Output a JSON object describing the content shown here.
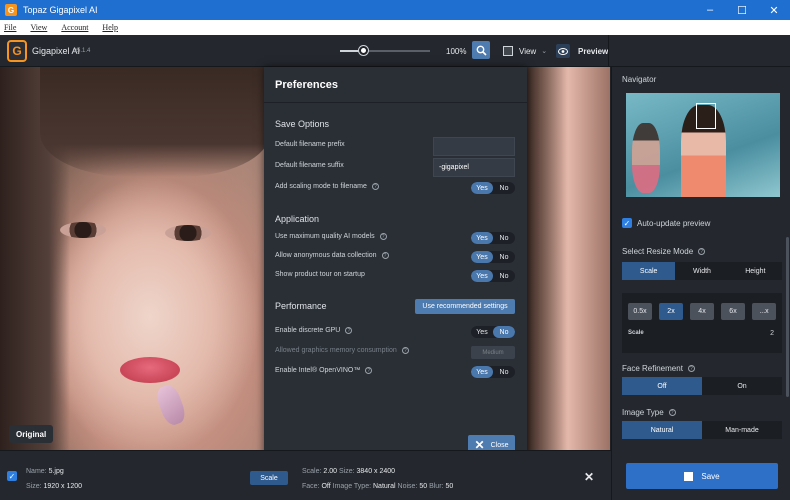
{
  "window": {
    "title": "Topaz Gigapixel AI",
    "app_icon_letter": "G",
    "minimize": "–",
    "maximize": "☐",
    "close": "✕"
  },
  "menu": [
    "File",
    "View",
    "Account",
    "Help"
  ],
  "toolbar": {
    "logo_letter": "G",
    "app_name": "Gigapixel AI",
    "version": "v5.1.4",
    "zoom_value": "100%",
    "view_label": "View",
    "preview_label": "Preview"
  },
  "image": {
    "original_label": "Original"
  },
  "preferences": {
    "title": "Preferences",
    "save_options": {
      "title": "Save Options",
      "prefix_label": "Default filename prefix",
      "prefix_value": "",
      "suffix_label": "Default filename suffix",
      "suffix_value": "-gigapixel",
      "add_scaling_label": "Add scaling mode to filename"
    },
    "application": {
      "title": "Application",
      "max_quality_label": "Use maximum quality AI models",
      "anon_data_label": "Allow anonymous data collection",
      "product_tour_label": "Show product tour on startup"
    },
    "performance": {
      "title": "Performance",
      "recommended_button": "Use recommended settings",
      "discrete_gpu_label": "Enable discrete GPU",
      "memory_label": "Allowed graphics memory consumption",
      "memory_value": "Medium",
      "openvino_label": "Enable Intel® OpenVINO™"
    },
    "toggle_yes": "Yes",
    "toggle_no": "No",
    "close_label": "Close",
    "help_glyph": "?"
  },
  "right_panel": {
    "navigator_title": "Navigator",
    "auto_update_label": "Auto-update preview",
    "resize_mode_title": "Select Resize Mode",
    "resize_modes": [
      "Scale",
      "Width",
      "Height"
    ],
    "scale_options": [
      "0.5x",
      "2x",
      "4x",
      "6x",
      "...x"
    ],
    "scale_label": "Scale",
    "scale_value": "2",
    "face_refinement_title": "Face Refinement",
    "face_options": [
      "Off",
      "On"
    ],
    "image_type_title": "Image Type",
    "image_types": [
      "Natural",
      "Man-made"
    ],
    "save_label": "Save"
  },
  "bottom_bar": {
    "name_label": "Name:",
    "name_value": "5.jpg",
    "size_label": "Size:",
    "size_value": "1920 x 1200",
    "mode_button": "Scale",
    "scale_label": "Scale:",
    "scale_value": "2.00",
    "out_size_label": "Size:",
    "out_size_value": "3840 x 2400",
    "face_label": "Face:",
    "face_value": "Off",
    "image_type_label": "Image Type:",
    "image_type_value": "Natural",
    "noise_label": "Noise:",
    "noise_value": "50",
    "blur_label": "Blur:",
    "blur_value": "50",
    "close_glyph": "✕"
  },
  "colors": {
    "accent": "#4e7bb0",
    "titlebar": "#1e6fd0",
    "brand_orange": "#f7941d"
  }
}
